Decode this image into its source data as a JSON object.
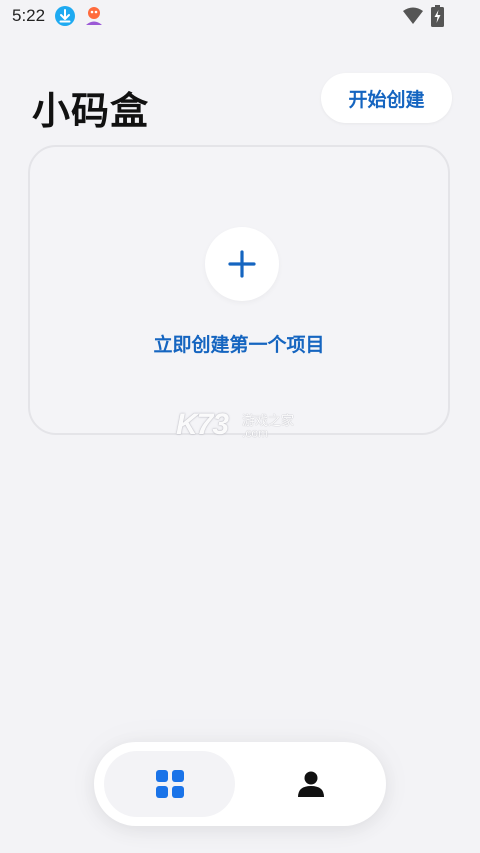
{
  "status_bar": {
    "time": "5:22",
    "icons": [
      "download-icon",
      "app-notification-icon",
      "wifi-icon",
      "battery-charging-icon"
    ]
  },
  "header": {
    "title": "小码盒",
    "start_button_label": "开始创建"
  },
  "empty_state": {
    "icon": "plus-icon",
    "label": "立即创建第一个项目"
  },
  "watermark": {
    "brand": "K73",
    "cn": "游戏之家",
    "domain": ".com"
  },
  "bottom_nav": {
    "tabs": [
      {
        "name": "home",
        "icon": "grid-icon",
        "selected": true
      },
      {
        "name": "profile",
        "icon": "person-icon",
        "selected": false
      }
    ]
  },
  "colors": {
    "accent": "#1565c0",
    "nav_active": "#1a73e8",
    "background": "#f3f3f6"
  }
}
